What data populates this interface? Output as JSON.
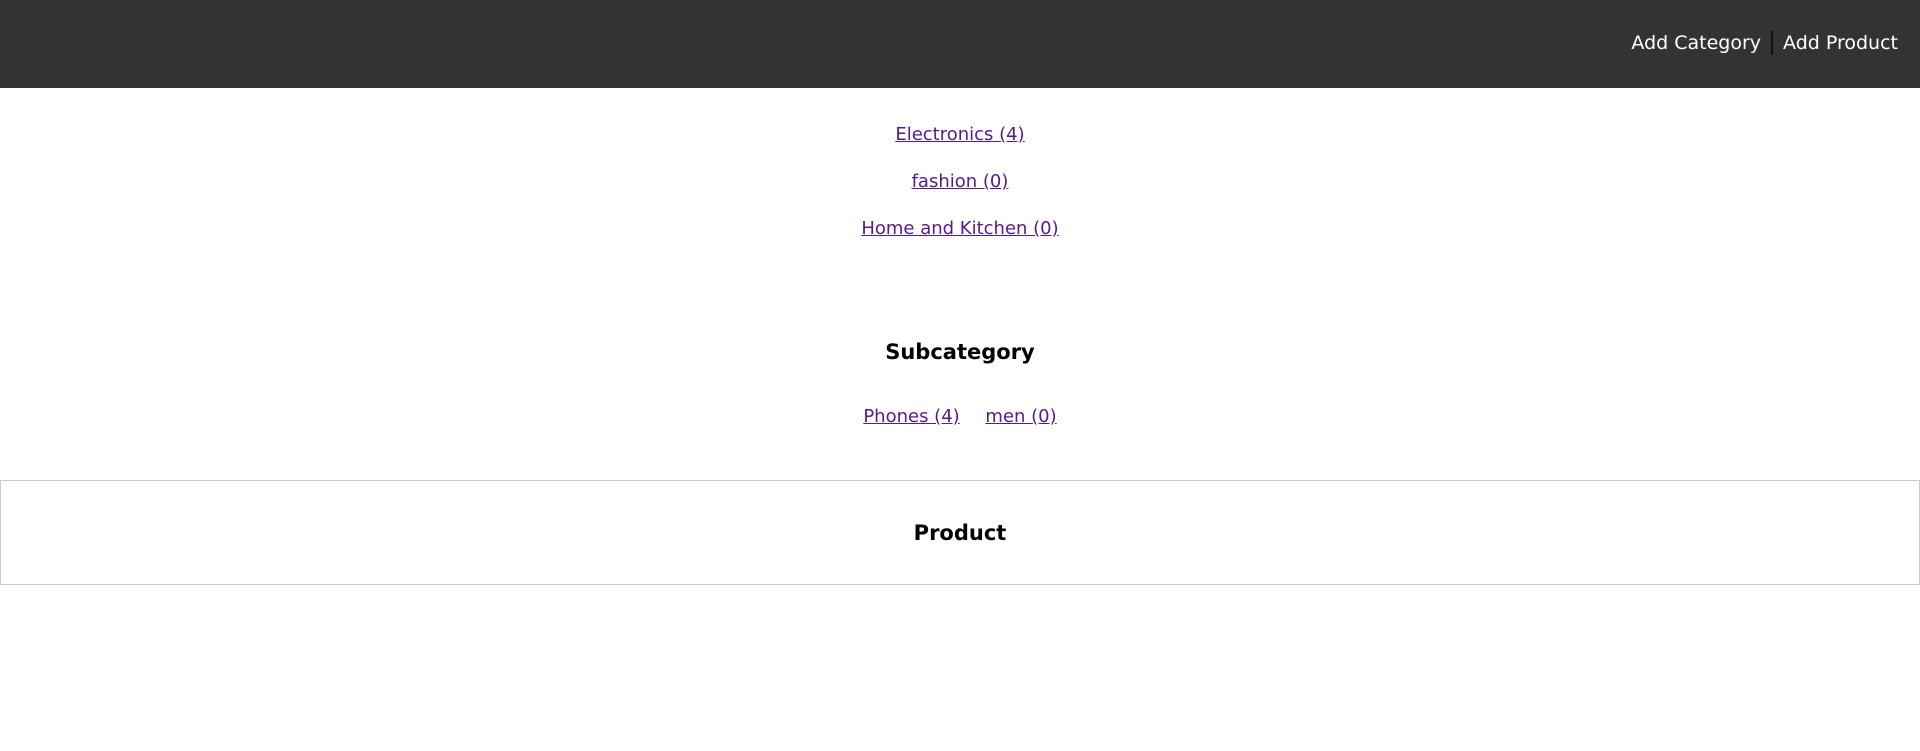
{
  "header": {
    "nav": [
      "Add Category",
      "Add Product"
    ]
  },
  "categories": [
    "Electronics (4)",
    "fashion (0)",
    "Home and Kitchen (0)"
  ],
  "subcategory": {
    "title": "Subcategory",
    "items": [
      "Phones (4)",
      "men (0)"
    ]
  },
  "product": {
    "title": "Product"
  }
}
